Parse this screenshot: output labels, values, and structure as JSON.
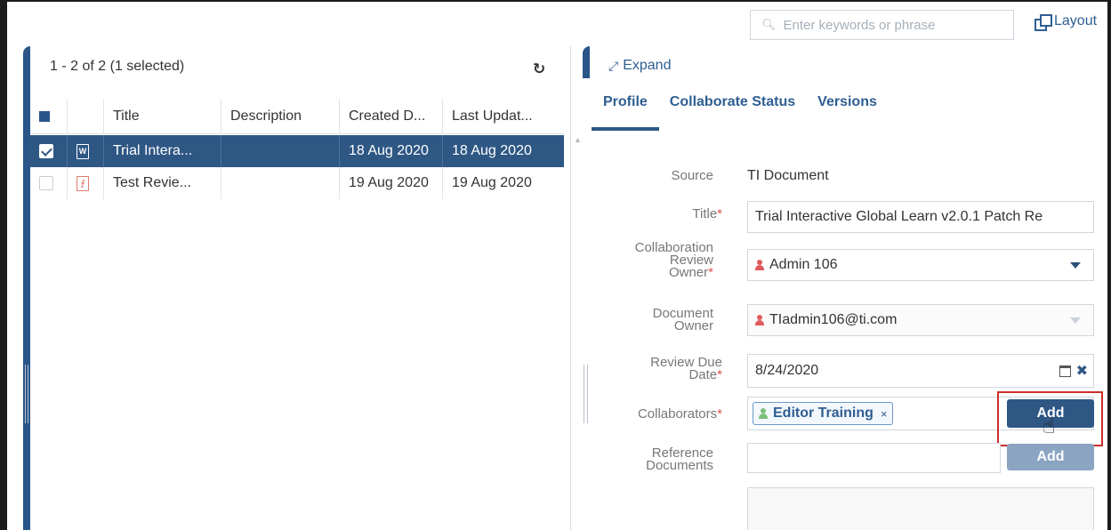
{
  "topbar": {
    "search_placeholder": "Enter keywords or phrase",
    "layout_label": "Layout"
  },
  "list": {
    "count_label": "1 - 2 of 2 (1 selected)",
    "columns": [
      "Title",
      "Description",
      "Created D...",
      "Last Updat..."
    ],
    "rows": [
      {
        "selected": true,
        "file_type": "word",
        "title": "Trial Intera...",
        "description": "",
        "created": "18 Aug 2020",
        "updated": "18 Aug 2020"
      },
      {
        "selected": false,
        "file_type": "pdf",
        "title": "Test Revie...",
        "description": "",
        "created": "19 Aug 2020",
        "updated": "19 Aug 2020"
      }
    ]
  },
  "detail": {
    "expand_label": "Expand",
    "tabs": [
      "Profile",
      "Collaborate Status",
      "Versions"
    ],
    "active_tab": "Profile",
    "source_label": "Source",
    "source_value": "TI Document",
    "title_label": "Title",
    "title_value": "Trial Interactive Global Learn v2.0.1 Patch Re",
    "owner_label_1": "Collaboration",
    "owner_label_2": "Review",
    "owner_label_3": "Owner",
    "owner_value": "Admin 106",
    "doc_owner_label_1": "Document",
    "doc_owner_label_2": "Owner",
    "doc_owner_value": "TIadmin106@ti.com",
    "due_label_1": "Review Due",
    "due_label_2": "Date",
    "due_value": "8/24/2020",
    "collab_label": "Collaborators",
    "collab_tag": "Editor Training",
    "tag_remove": "×",
    "clear_symbol": "✖",
    "add_label": "Add",
    "ref_label_1": "Reference",
    "ref_label_2": "Documents",
    "ref_add_label": "Add",
    "required_mark": "*"
  },
  "colors": {
    "accent": "#2e5784",
    "link": "#2e5e91",
    "required": "#d9534f",
    "highlight": "#c9302c"
  }
}
